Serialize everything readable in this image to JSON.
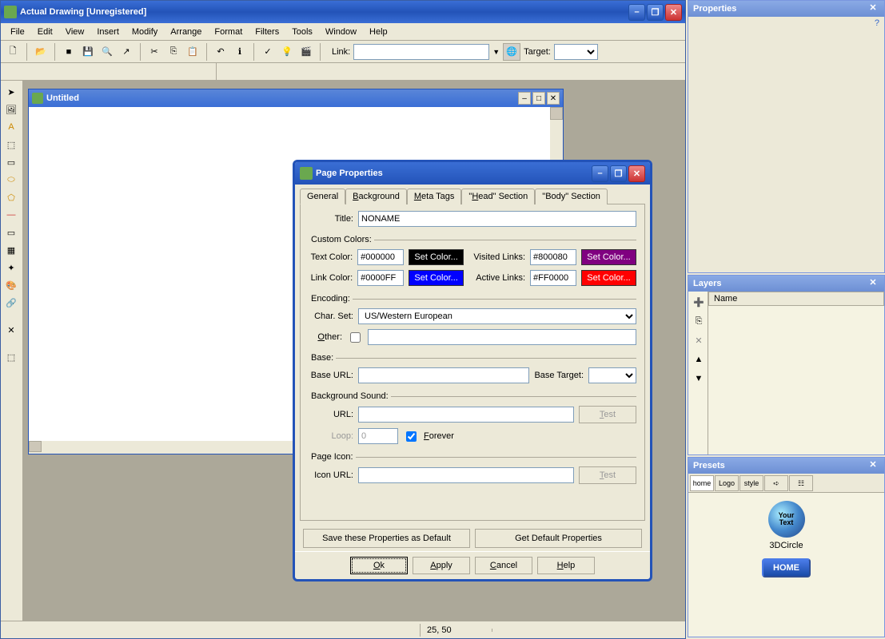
{
  "app": {
    "title": "Actual Drawing [Unregistered]"
  },
  "menu": [
    "File",
    "Edit",
    "View",
    "Insert",
    "Modify",
    "Arrange",
    "Format",
    "Filters",
    "Tools",
    "Window",
    "Help"
  ],
  "toolbar_link": {
    "link_label": "Link:",
    "target_label": "Target:"
  },
  "doc": {
    "title": "Untitled"
  },
  "status": {
    "coords": "25, 50"
  },
  "dialog": {
    "title": "Page Properties",
    "tabs": [
      "General",
      "Background",
      "Meta Tags",
      "\"Head\" Section",
      "\"Body\" Section"
    ],
    "title_label": "Title:",
    "title_value": "NONAME",
    "custom_colors_label": "Custom Colors:",
    "text_color_label": "Text Color:",
    "text_color_value": "#000000",
    "link_color_label": "Link Color:",
    "link_color_value": "#0000FF",
    "visited_label": "Visited Links:",
    "visited_value": "#800080",
    "active_label": "Active Links:",
    "active_value": "#FF0000",
    "setcolor_label": "Set Color...",
    "encoding_label": "Encoding:",
    "charset_label": "Char. Set:",
    "charset_value": "US/Western European",
    "other_label": "Other:",
    "base_label": "Base:",
    "baseurl_label": "Base URL:",
    "basetarget_label": "Base Target:",
    "bgsound_label": "Background Sound:",
    "url_label": "URL:",
    "loop_label": "Loop:",
    "loop_value": "0",
    "forever_label": "Forever",
    "forever_checked": true,
    "test_label": "Test",
    "pageicon_label": "Page Icon:",
    "iconurl_label": "Icon URL:",
    "save_default": "Save these Properties as Default",
    "get_default": "Get Default Properties",
    "ok": "Ok",
    "apply": "Apply",
    "cancel": "Cancel",
    "help": "Help"
  },
  "panels": {
    "properties": "Properties",
    "layers": "Layers",
    "layers_name": "Name",
    "presets": "Presets",
    "preset_circle_text": "Your\nText",
    "preset_circle_name": "3DCircle",
    "preset_home": "HOME",
    "preset_tabs": [
      "home",
      "Logo",
      "style",
      "➪",
      "☷"
    ]
  },
  "colors": {
    "text": "#000000",
    "link": "#0000FF",
    "visited": "#800080",
    "active": "#FF0000"
  }
}
